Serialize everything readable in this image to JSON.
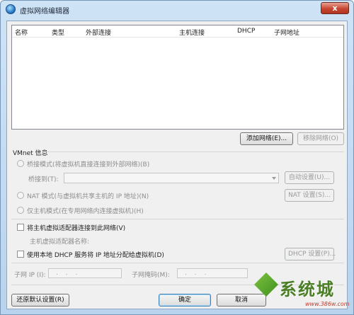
{
  "window": {
    "title": "虚拟网络编辑器",
    "close_label": "x"
  },
  "list": {
    "columns": [
      "名称",
      "类型",
      "外部连接",
      "主机连接",
      "DHCP",
      "子网地址"
    ]
  },
  "buttons": {
    "add_network": "添加网络(E)...",
    "remove_network": "移除网络(O)",
    "auto_settings": "自动设置(U)...",
    "nat_settings": "NAT 设置(S)...",
    "dhcp_settings": "DHCP 设置(P)...",
    "restore_defaults": "还原默认设置(R)",
    "ok": "确定",
    "cancel": "取消"
  },
  "vmnet": {
    "group_label": "VMnet 信息",
    "bridged_mode": "桥接模式(将虚拟机直接连接到外部网络)(B)",
    "bridged_to_label": "桥接到(T):",
    "nat_mode": "NAT 模式(与虚拟机共享主机的 IP 地址)(N)",
    "host_only_mode": "仅主机模式(在专用网络内连接虚拟机)(H)",
    "connect_adapter": "将主机虚拟适配器连接到此网络(V)",
    "adapter_name_label": "主机虚拟适配器名称:",
    "use_dhcp": "使用本地 DHCP 服务将 IP 地址分配给虚拟机(D)",
    "subnet_ip_label": "子网 IP (I):",
    "subnet_mask_label": "子网掩码(M):",
    "ip_placeholder": ". . .",
    "mask_placeholder": ". . ."
  },
  "watermark": {
    "text": "系统城",
    "url": "www.386w.com"
  }
}
